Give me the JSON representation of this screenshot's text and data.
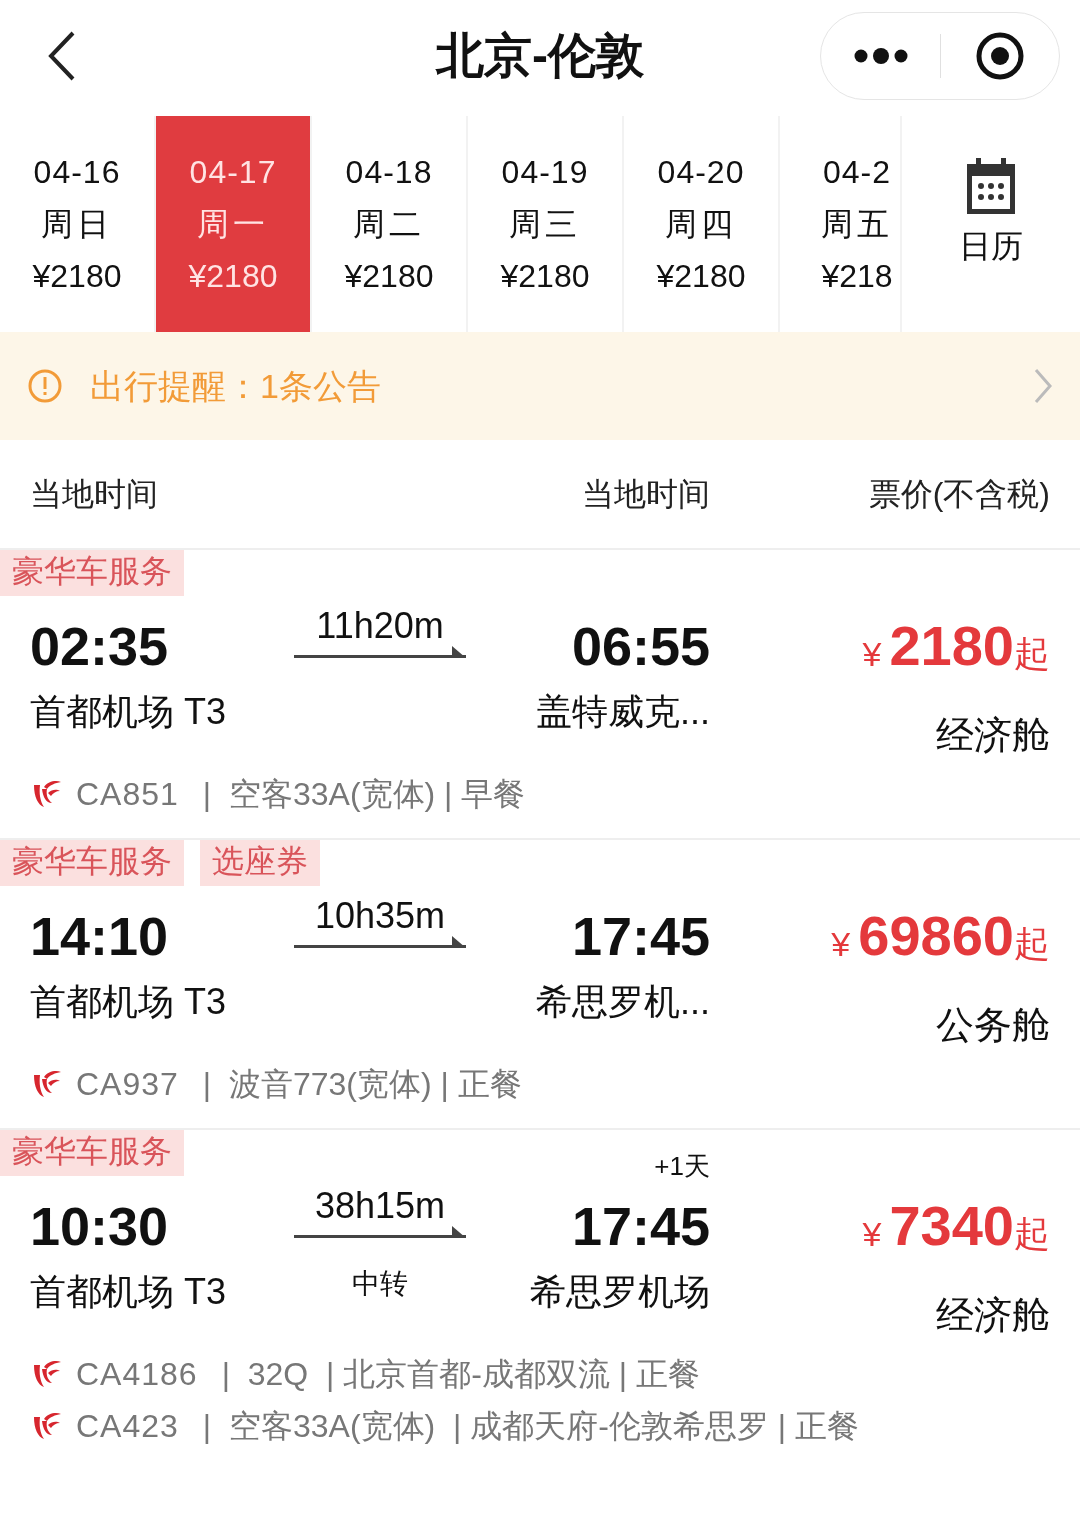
{
  "header": {
    "title": "北京-伦敦"
  },
  "dates": [
    {
      "date": "04-16",
      "weekday": "周日",
      "price": "¥2180",
      "selected": false
    },
    {
      "date": "04-17",
      "weekday": "周一",
      "price": "¥2180",
      "selected": true
    },
    {
      "date": "04-18",
      "weekday": "周二",
      "price": "¥2180",
      "selected": false
    },
    {
      "date": "04-19",
      "weekday": "周三",
      "price": "¥2180",
      "selected": false
    },
    {
      "date": "04-20",
      "weekday": "周四",
      "price": "¥2180",
      "selected": false
    },
    {
      "date": "04-2",
      "weekday": "周五",
      "price": "¥218",
      "selected": false
    }
  ],
  "calendar_button": {
    "label": "日历"
  },
  "notice": {
    "text": "出行提醒：1条公告"
  },
  "columns": [
    "当地时间",
    "当地时间",
    "票价(不含税)"
  ],
  "flights": [
    {
      "tags": [
        "豪华车服务"
      ],
      "dep_time": "02:35",
      "duration": "11h20m",
      "arr_time": "06:55",
      "dep_airport": "首都机场 T3",
      "arr_airport": "盖特威克...",
      "currency": "¥",
      "price": "2180",
      "price_suffix": "起",
      "cabin": "经济舱",
      "segments": [
        {
          "flight_no": "CA851",
          "details": "|  空客33A(宽体) | 早餐"
        }
      ]
    },
    {
      "tags": [
        "豪华车服务",
        "选座券"
      ],
      "dep_time": "14:10",
      "duration": "10h35m",
      "arr_time": "17:45",
      "dep_airport": "首都机场 T3",
      "arr_airport": "希思罗机...",
      "currency": "¥",
      "price": "69860",
      "price_suffix": "起",
      "cabin": "公务舱",
      "segments": [
        {
          "flight_no": "CA937",
          "details": "|  波音773(宽体) | 正餐"
        }
      ]
    },
    {
      "tags": [
        "豪华车服务"
      ],
      "dep_time": "10:30",
      "duration": "38h15m",
      "arr_time": "17:45",
      "day_offset": "+1天",
      "transfer": "中转",
      "dep_airport": "首都机场 T3",
      "arr_airport": "希思罗机场",
      "currency": "¥",
      "price": "7340",
      "price_suffix": "起",
      "cabin": "经济舱",
      "segments": [
        {
          "flight_no": "CA4186",
          "details": "|  32Q  | 北京首都-成都双流 | 正餐"
        },
        {
          "flight_no": "CA423",
          "details": "|  空客33A(宽体)  | 成都天府-伦敦希思罗 | 正餐"
        }
      ]
    }
  ]
}
